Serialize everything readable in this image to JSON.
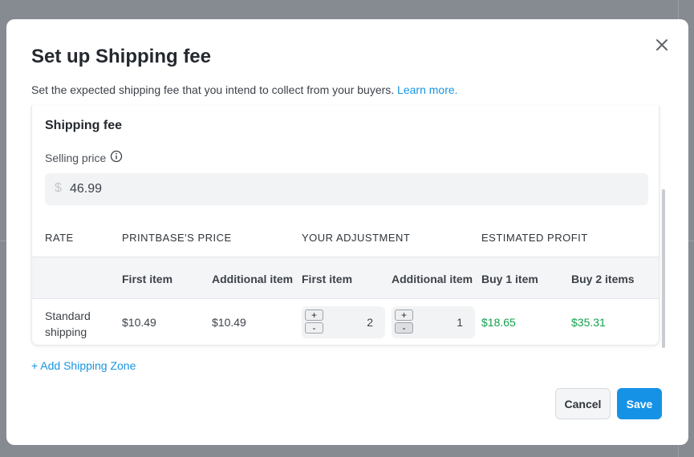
{
  "modal": {
    "title": "Set up Shipping fee",
    "subtitle": "Set the expected shipping fee that you intend to collect from your buyers.",
    "learn_more": "Learn more.",
    "close_icon": "close-icon"
  },
  "shipping_fee": {
    "section_title": "Shipping fee",
    "selling_price_label": "Selling price",
    "info_icon": "info-icon",
    "currency_symbol": "$",
    "selling_price_value": "46.99"
  },
  "table": {
    "headers": [
      "RATE",
      "PRINTBASE'S PRICE",
      "YOUR ADJUSTMENT",
      "ESTIMATED PROFIT"
    ],
    "subheaders": [
      "First item",
      "Additional item",
      "First item",
      "Additional item",
      "Buy 1 item",
      "Buy 2 items"
    ],
    "rows": [
      {
        "rate": "Standard shipping",
        "price_first": "$10.49",
        "price_additional": "$10.49",
        "adjust_first": "2",
        "adjust_additional": "1",
        "profit_1": "$18.65",
        "profit_2": "$35.31"
      }
    ],
    "stepper_plus": "+",
    "stepper_minus": "-"
  },
  "add_zone_label": "+ Add Shipping Zone",
  "buttons": {
    "cancel": "Cancel",
    "save": "Save"
  },
  "colors": {
    "accent": "#1592e6",
    "link": "#1796e0",
    "profit": "#11a04d"
  }
}
